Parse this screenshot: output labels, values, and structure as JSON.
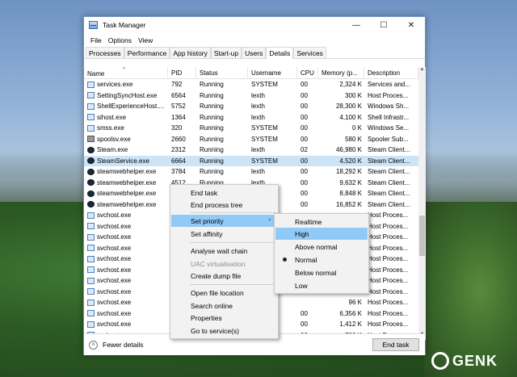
{
  "window": {
    "title": "Task Manager",
    "controls": {
      "minimize": "—",
      "maximize": "☐",
      "close": "✕"
    }
  },
  "menubar": [
    "File",
    "Options",
    "View"
  ],
  "tabs": [
    "Processes",
    "Performance",
    "App history",
    "Start-up",
    "Users",
    "Details",
    "Services"
  ],
  "active_tab": "Details",
  "columns": [
    "Name",
    "PID",
    "Status",
    "Username",
    "CPU",
    "Memory (p...",
    "Description"
  ],
  "rows": [
    [
      "services.exe",
      "792",
      "Running",
      "SYSTEM",
      "00",
      "2,324 K",
      "Services and..."
    ],
    [
      "SettingSyncHost.exe",
      "6564",
      "Running",
      "lexth",
      "00",
      "300 K",
      "Host Proces..."
    ],
    [
      "ShellExperienceHost....",
      "5752",
      "Running",
      "lexth",
      "00",
      "28,300 K",
      "Windows Sh..."
    ],
    [
      "sihost.exe",
      "1364",
      "Running",
      "lexth",
      "00",
      "4,100 K",
      "Shell Infrastr..."
    ],
    [
      "smss.exe",
      "320",
      "Running",
      "SYSTEM",
      "00",
      "0 K",
      "Windows Se..."
    ],
    [
      "spoolsv.exe",
      "2660",
      "Running",
      "SYSTEM",
      "00",
      "580 K",
      "Spooler Sub..."
    ],
    [
      "Steam.exe",
      "2312",
      "Running",
      "lexth",
      "02",
      "46,980 K",
      "Steam Client..."
    ],
    [
      "SteamService.exe",
      "6664",
      "Running",
      "SYSTEM",
      "00",
      "4,520 K",
      "Steam Client..."
    ],
    [
      "steamwebhelper.exe",
      "3784",
      "Running",
      "lexth",
      "00",
      "18,292 K",
      "Steam Client..."
    ],
    [
      "steamwebhelper.exe",
      "4512",
      "Running",
      "lexth",
      "00",
      "9,632 K",
      "Steam Client..."
    ],
    [
      "steamwebhelper.exe",
      "",
      "",
      "",
      "00",
      "8,848 K",
      "Steam Client..."
    ],
    [
      "steamwebhelper.exe",
      "",
      "",
      "",
      "00",
      "16,852 K",
      "Steam Client..."
    ],
    [
      "svchost.exe",
      "",
      "",
      "",
      "",
      "",
      "Host Proces..."
    ],
    [
      "svchost.exe",
      "",
      "",
      "",
      "",
      "",
      "Host Proces..."
    ],
    [
      "svchost.exe",
      "",
      "",
      "",
      "",
      "",
      "Host Proces..."
    ],
    [
      "svchost.exe",
      "",
      "",
      "",
      "",
      "",
      "Host Proces..."
    ],
    [
      "svchost.exe",
      "",
      "",
      "",
      "",
      "",
      "Host Proces..."
    ],
    [
      "svchost.exe",
      "",
      "",
      "",
      "",
      "",
      "Host Proces..."
    ],
    [
      "svchost.exe",
      "",
      "",
      "",
      "",
      "",
      "Host Proces..."
    ],
    [
      "svchost.exe",
      "",
      "",
      "",
      "",
      "",
      "Host Proces..."
    ],
    [
      "svchost.exe",
      "",
      "",
      "",
      "",
      "96 K",
      "Host Proces..."
    ],
    [
      "svchost.exe",
      "",
      "",
      "E...",
      "00",
      "6,356 K",
      "Host Proces..."
    ],
    [
      "svchost.exe",
      "",
      "",
      "E...",
      "00",
      "1,412 K",
      "Host Proces..."
    ],
    [
      "svchost.exe",
      "",
      "",
      "E...",
      "00",
      "780 K",
      "Host Proces..."
    ]
  ],
  "icons": [
    "app-icon",
    "app-icon",
    "app-icon",
    "app-icon",
    "app-icon",
    "printer-icon",
    "steam-icon",
    "steam-icon",
    "steam-icon",
    "steam-icon",
    "steam-icon",
    "steam-icon",
    "app-icon",
    "app-icon",
    "app-icon",
    "app-icon",
    "app-icon",
    "app-icon",
    "app-icon",
    "app-icon",
    "app-icon",
    "app-icon",
    "app-icon",
    "app-icon"
  ],
  "selected_row": 7,
  "context_menu": {
    "end_task": "End task",
    "end_process_tree": "End process tree",
    "set_priority": "Set priority",
    "set_affinity": "Set affinity",
    "analyse_wait_chain": "Analyse wait chain",
    "uac_virtualisation": "UAC virtualisation",
    "create_dump_file": "Create dump file",
    "open_file_location": "Open file location",
    "search_online": "Search online",
    "properties": "Properties",
    "go_to_services": "Go to service(s)"
  },
  "priority_menu": {
    "realtime": "Realtime",
    "high": "High",
    "above_normal": "Above normal",
    "normal": "Normal",
    "below_normal": "Below normal",
    "low": "Low",
    "checked": "Normal",
    "highlighted": "High"
  },
  "footer": {
    "fewer_details": "Fewer details",
    "end_task": "End task"
  },
  "watermark": "GENK",
  "colors": {
    "selection": "#cce4f7",
    "menu_highlight": "#91c9f7"
  }
}
